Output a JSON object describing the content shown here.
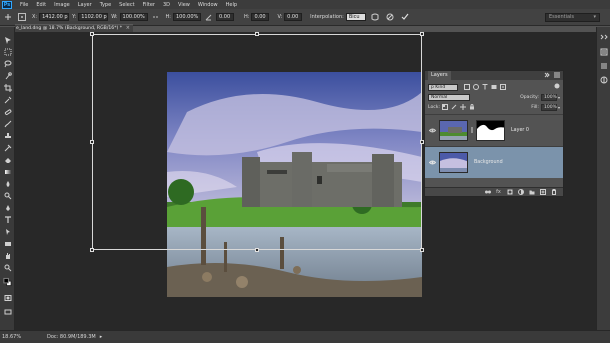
{
  "app": {
    "logo_text": "Ps"
  },
  "menu": [
    "File",
    "Edit",
    "Image",
    "Layer",
    "Type",
    "Select",
    "Filter",
    "3D",
    "View",
    "Window",
    "Help"
  ],
  "options_bar": {
    "x_label": "X:",
    "x_value": "1412.00 p",
    "y_label": "Y:",
    "y_value": "1102.00 p",
    "w_label": "W:",
    "w_value": "100.00%",
    "h_label": "H:",
    "h_value": "100.00%",
    "angle_value": "0.00",
    "hskew_label": "H:",
    "hskew_value": "0.00",
    "vskew_label": "V:",
    "vskew_value": "0.00",
    "interpolation_label": "Interpolation:",
    "interpolation_value": "Bicu",
    "workspace_value": "Essentials"
  },
  "document_tab": {
    "title": "e_land.dng @ 18.7% (Background, RGB/16*) *",
    "close": "×"
  },
  "layers_panel": {
    "tab_label": "Layers",
    "filter_kind": "p Kind",
    "blend_mode": "Normal",
    "opacity_label": "Opacity:",
    "opacity_value": "100%",
    "lock_label": "Lock:",
    "fill_label": "Fill:",
    "fill_value": "100%",
    "layers": [
      {
        "name": "Layer 0",
        "selected": false
      },
      {
        "name": "Background",
        "selected": true
      }
    ],
    "footer_icons": [
      "link-icon",
      "fx-icon",
      "mask-icon",
      "adjustment-icon",
      "group-icon",
      "new-layer-icon",
      "trash-icon"
    ],
    "footer_fx": "fx"
  },
  "status_bar": {
    "zoom": "18.67%",
    "doc_info": "Doc: 80.9M/189.3M",
    "arrow": "▸"
  },
  "colors": {
    "canvas_bg": "#282828",
    "panel_bg": "#535353",
    "selected_layer": "#7b93ab",
    "accent": "#31a8ff"
  }
}
